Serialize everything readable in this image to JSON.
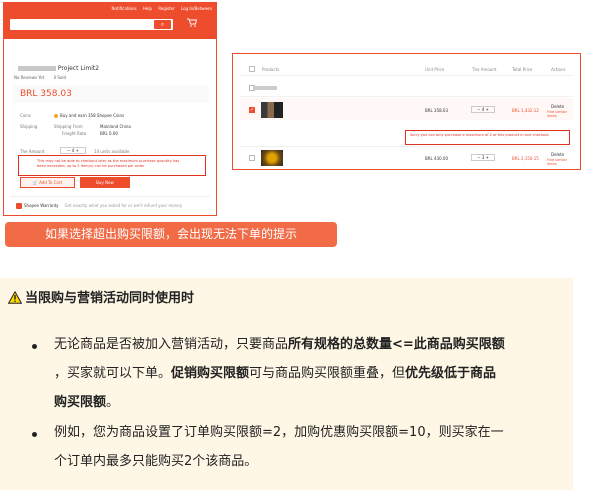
{
  "left_screenshot": {
    "top_nav": [
      "Notifications",
      "Help",
      "Register",
      "Log In/Between"
    ],
    "search_button": "⌕",
    "cart_icon": "cart-icon",
    "title": "Project Limit2",
    "meta": [
      "No Reviews Yet",
      "0 Sold"
    ],
    "price": "BRL 358.03",
    "coins_label": "Coins",
    "coins_value": "Buy and earn 358 Shopee Coins",
    "shipping_label": "Shipping",
    "shipping_from_label": "Shipping From",
    "shipping_from_value": "Mainland China",
    "freight_label": "Freight Rate",
    "freight_value": "BRL 0.00",
    "amount_label": "The Amount",
    "qty_value": "4",
    "available": "14 units available",
    "error_text": "This may not be able to checkout later as the maximum purchase quantity has been exceeded, up to 2 item(s) can be purchased per order",
    "add_to_cart": "Add To Cart",
    "buy_now": "Buy Now",
    "guarantee_label": "Shopee Warranty",
    "guarantee_desc": "Get exactly what you asked for or we'll refund your money"
  },
  "right_screenshot": {
    "headers": [
      "Products",
      "Unit Price",
      "The Amount",
      "Total Price",
      "Actions"
    ],
    "rows": [
      {
        "unit": "BRL 358.03",
        "qty": "4",
        "total": "BRL 1,432.12",
        "action": "Delete",
        "similar": "Find similar items"
      },
      {
        "unit": "BRL 430.00",
        "qty": "3",
        "total": "BRL 2,150.15",
        "action": "Delete",
        "similar": "Find similar items"
      }
    ],
    "error_text": "Sorry you can only purchase a maximum of 2 of this product in one checkout"
  },
  "caption": "如果选择超出购买限额，会出现无法下单的提示",
  "notice": {
    "title": "当限购与营销活动同时使用时",
    "p1_a": "无论商品是否被加入营销活动，只要商品",
    "p1_b": "所有规格的总数量<=此商品购买限额",
    "p1_c": "，买家就可以下单。",
    "p1_d": "促销购买限额",
    "p1_e": "可与商品购买限额重叠，但",
    "p1_f": "优先级低于商品",
    "p1_g": "购买限额",
    "p1_h": "。",
    "p2_a": "例如，您为商品设置了订单购买限额=2，加购优惠购买限额=10，则买家在一",
    "p2_b": "个订单内最多只能购买2个该商品。"
  },
  "colors": {
    "brand": "#ee4d2d",
    "caption_bg": "#f26b47",
    "notice_bg": "#fff7e6",
    "error": "#e0301e"
  }
}
